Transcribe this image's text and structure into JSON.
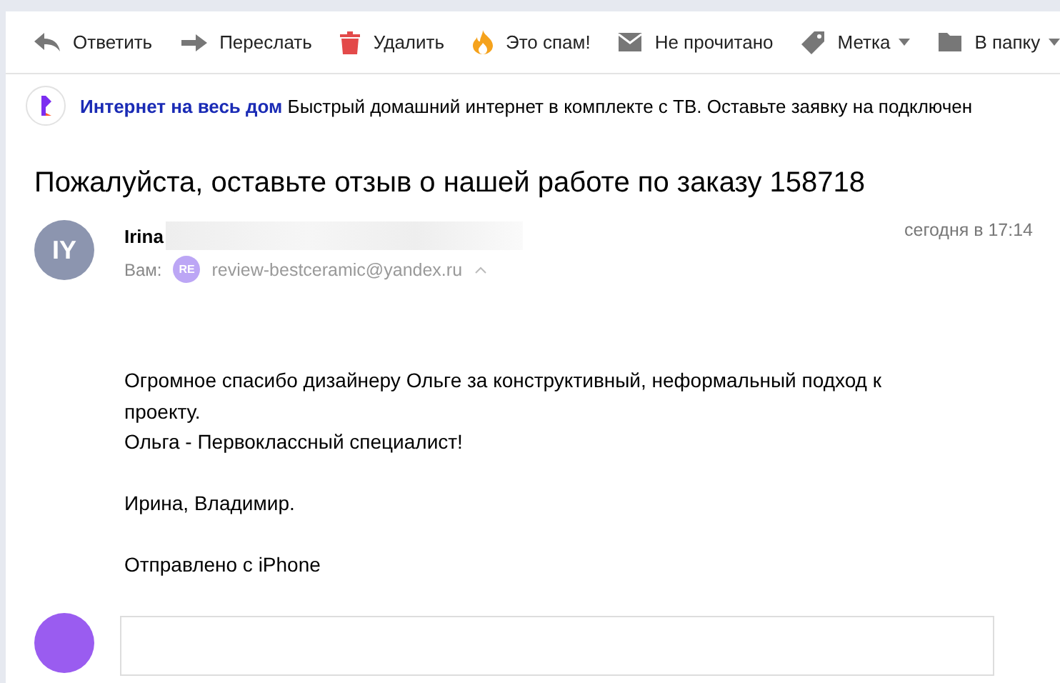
{
  "toolbar": [
    {
      "kind": "reply",
      "label": "Ответить"
    },
    {
      "kind": "forward",
      "label": "Переслать"
    },
    {
      "kind": "delete",
      "label": "Удалить"
    },
    {
      "kind": "spam",
      "label": "Это спам!"
    },
    {
      "kind": "unread",
      "label": "Не прочитано"
    },
    {
      "kind": "label",
      "label": "Метка",
      "dropdown": true
    },
    {
      "kind": "folder",
      "label": "В папку",
      "dropdown": true
    }
  ],
  "ad": {
    "title": "Интернет на весь дом",
    "text": "Быстрый домашний интернет в комплекте с ТВ. Оставьте заявку на подключен"
  },
  "message": {
    "subject": "Пожалуйста, оставьте отзыв о нашей работе по заказу 158718",
    "sender": {
      "initials": "IY",
      "name": "Irina",
      "time": "сегодня в 17:14"
    },
    "recipient": {
      "prefix": "Вам:",
      "initials": "RE",
      "address": "review-bestceramic@yandex.ru"
    },
    "body": [
      [
        "Огромное спасибо дизайнеру Ольге за конструктивный, неформальный подход к проекту.",
        "Ольга - Первоклассный специалист!"
      ],
      [
        "Ирина, Владимир."
      ],
      [
        "Отправлено с iPhone"
      ]
    ]
  }
}
